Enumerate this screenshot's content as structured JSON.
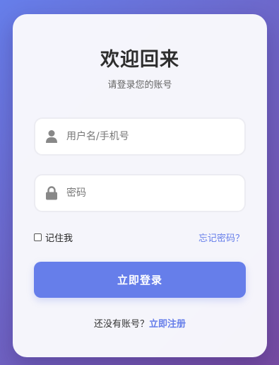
{
  "header": {
    "title": "欢迎回来",
    "subtitle": "请登录您的账号"
  },
  "form": {
    "username": {
      "placeholder": "用户名/手机号",
      "icon": "user-icon"
    },
    "password": {
      "placeholder": "密码",
      "icon": "lock-icon"
    },
    "remember_label": "记住我",
    "remember_checked": false,
    "forgot_label": "忘记密码？",
    "submit_label": "立即登录"
  },
  "footer": {
    "prompt": "还没有账号？",
    "register_label": "立即注册"
  },
  "colors": {
    "accent": "#667eea",
    "background_start": "#667eea",
    "background_end": "#764ba2"
  }
}
